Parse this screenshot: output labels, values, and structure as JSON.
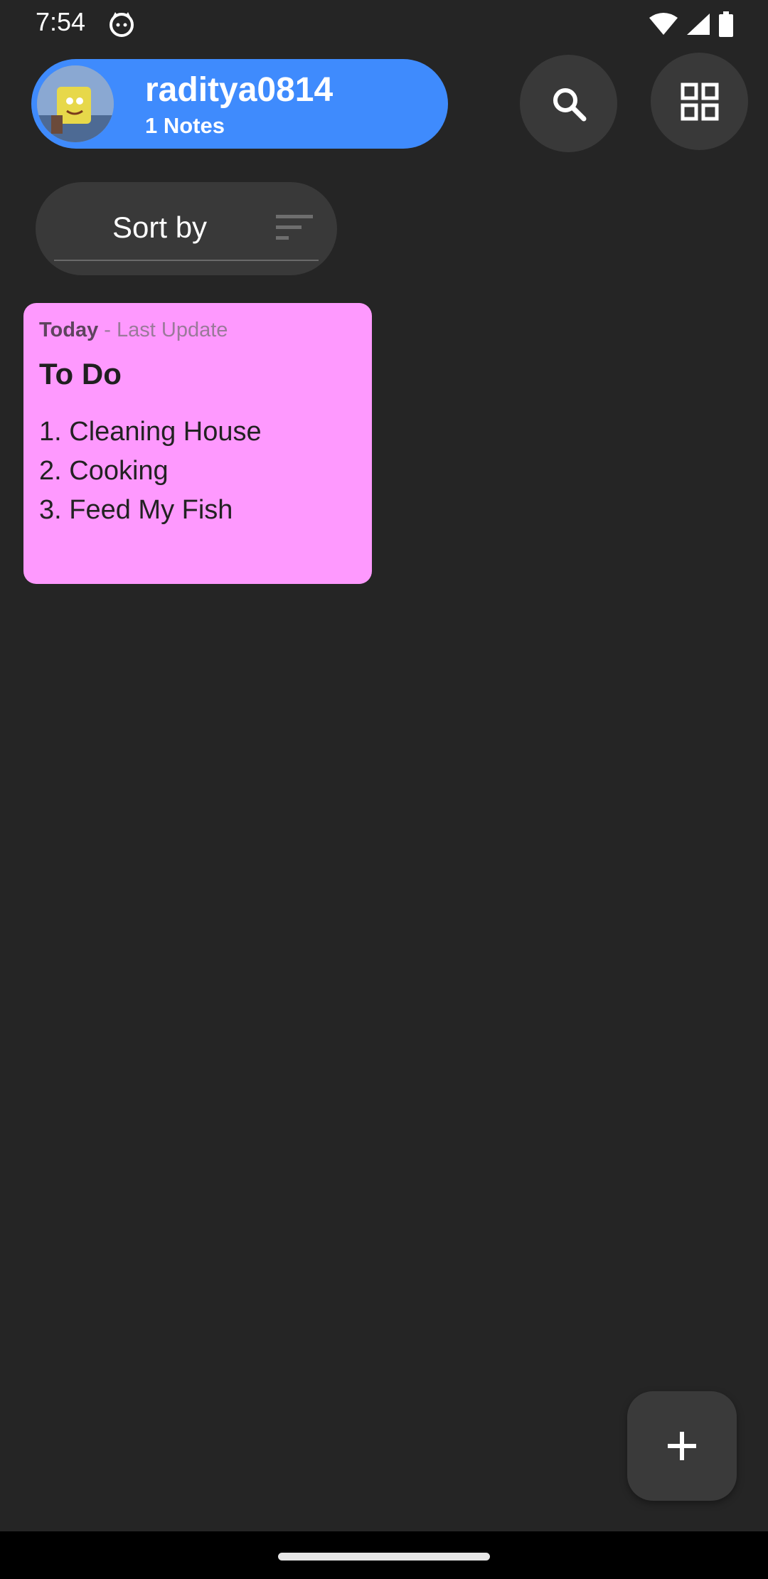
{
  "status_bar": {
    "time": "7:54",
    "app_icon": "cat-icon",
    "icons": [
      "wifi-icon",
      "cell-signal-icon",
      "battery-icon"
    ]
  },
  "profile": {
    "username": "raditya0814",
    "notes_count": "1 Notes",
    "pill_color": "#3f8bfd"
  },
  "toolbar": {
    "search_icon": "search-icon",
    "layout_icon": "grid-view-icon"
  },
  "sort": {
    "label": "Sort by",
    "icon": "sort-icon"
  },
  "notes": [
    {
      "date": "Today",
      "update_label": " - Last Update",
      "title": "To Do",
      "lines": [
        "1. Cleaning House",
        "2. Cooking",
        "3. Feed My Fish"
      ],
      "color": "#fe99fe"
    }
  ],
  "fab": {
    "icon": "add-icon"
  }
}
